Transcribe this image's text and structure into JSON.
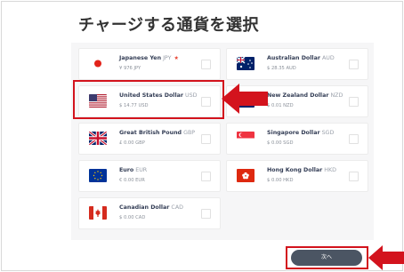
{
  "page": {
    "title": "チャージする通貨を選択",
    "next_button": "次へ"
  },
  "currencies": [
    {
      "name": "Japanese Yen",
      "code": "JPY",
      "star": "★",
      "amount": "¥ 976 JPY",
      "flag": "jp"
    },
    {
      "name": "Australian Dollar",
      "code": "AUD",
      "amount": "$ 28.35 AUD",
      "flag": "au"
    },
    {
      "name": "United States Dollar",
      "code": "USD",
      "amount": "$ 14.77 USD",
      "flag": "us"
    },
    {
      "name": "New Zealand Dollar",
      "code": "NZD",
      "amount": "$ 0.01 NZD",
      "flag": "nz"
    },
    {
      "name": "Great British Pound",
      "code": "GBP",
      "amount": "£ 0.00 GBP",
      "flag": "gb"
    },
    {
      "name": "Singapore Dollar",
      "code": "SGD",
      "amount": "$ 0.00 SGD",
      "flag": "sg"
    },
    {
      "name": "Euro",
      "code": "EUR",
      "amount": "€ 0.00 EUR",
      "flag": "eu"
    },
    {
      "name": "Hong Kong Dollar",
      "code": "HKD",
      "amount": "$ 0.00 HKD",
      "flag": "hk"
    },
    {
      "name": "Canadian Dollar",
      "code": "CAD",
      "amount": "$ 0.00 CAD",
      "flag": "ca"
    }
  ],
  "colors": {
    "highlight": "#d3131d",
    "button": "#4b5563"
  }
}
